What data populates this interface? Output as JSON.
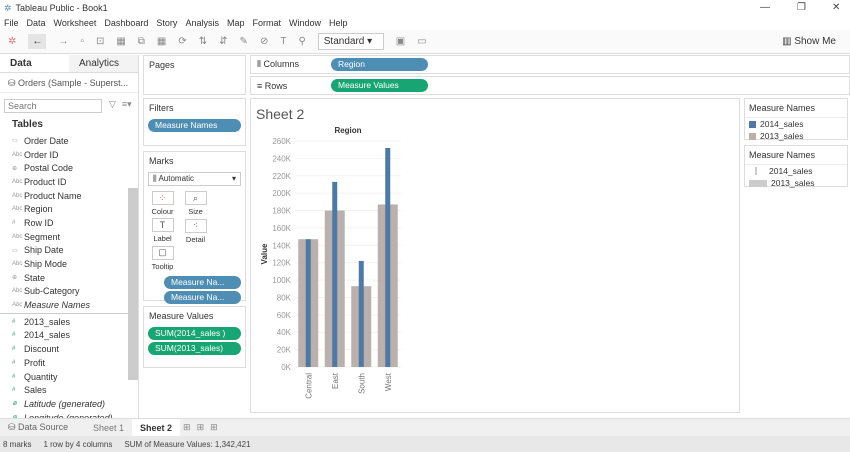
{
  "window": {
    "title": "Tableau Public - Book1"
  },
  "menu": [
    "File",
    "Data",
    "Worksheet",
    "Dashboard",
    "Story",
    "Analysis",
    "Map",
    "Format",
    "Window",
    "Help"
  ],
  "toolbar": {
    "fit": "Standard",
    "show_me": "Show Me"
  },
  "left": {
    "tabs": [
      "Data",
      "Analytics"
    ],
    "source": "Orders (Sample - Superst...",
    "search_placeholder": "Search",
    "tables_label": "Tables",
    "dimensions": [
      {
        "name": "Order Date",
        "icon": "date"
      },
      {
        "name": "Order ID",
        "icon": "abc"
      },
      {
        "name": "Postal Code",
        "icon": "geo"
      },
      {
        "name": "Product ID",
        "icon": "abc"
      },
      {
        "name": "Product Name",
        "icon": "abc"
      },
      {
        "name": "Region",
        "icon": "abc"
      },
      {
        "name": "Row ID",
        "icon": "num"
      },
      {
        "name": "Segment",
        "icon": "abc"
      },
      {
        "name": "Ship Date",
        "icon": "date"
      },
      {
        "name": "Ship Mode",
        "icon": "abc"
      },
      {
        "name": "State",
        "icon": "geo"
      },
      {
        "name": "Sub-Category",
        "icon": "abc"
      },
      {
        "name": "Measure Names",
        "icon": "abc"
      }
    ],
    "measures": [
      {
        "name": "2013_sales",
        "icon": "num"
      },
      {
        "name": "2014_sales",
        "icon": "num"
      },
      {
        "name": "Discount",
        "icon": "num"
      },
      {
        "name": "Profit",
        "icon": "num"
      },
      {
        "name": "Quantity",
        "icon": "num"
      },
      {
        "name": "Sales",
        "icon": "num"
      },
      {
        "name": "Latitude (generated)",
        "icon": "geo"
      },
      {
        "name": "Longitude (generated)",
        "icon": "geo"
      }
    ]
  },
  "pages": {
    "title": "Pages"
  },
  "filters": {
    "title": "Filters",
    "pills": [
      "Measure Names"
    ]
  },
  "marks": {
    "title": "Marks",
    "type": "Automatic",
    "buttons": [
      "Colour",
      "Size",
      "Label",
      "Detail",
      "Tooltip"
    ],
    "pills": [
      "Measure Na...",
      "Measure Na..."
    ]
  },
  "measure_values": {
    "title": "Measure Values",
    "pills": [
      "SUM(2014_sales )",
      "SUM(2013_sales)"
    ]
  },
  "shelves": {
    "columns_label": "Columns",
    "columns_pill": "Region",
    "rows_label": "Rows",
    "rows_pill": "Measure Values"
  },
  "sheet": {
    "title": "Sheet 2"
  },
  "legends": [
    {
      "title": "Measure Names",
      "items": [
        "2014_sales",
        "2013_sales"
      ]
    },
    {
      "title": "Measure Names",
      "items": [
        "2014_sales",
        "2013_sales"
      ]
    }
  ],
  "tabs": {
    "data_source": "Data Source",
    "sheets": [
      "Sheet 1",
      "Sheet 2"
    ],
    "active": "Sheet 2"
  },
  "status": {
    "marks": "8 marks",
    "dims": "1 row by 4 columns",
    "sum": "SUM of Measure Values: 1,342,421"
  },
  "colors": {
    "sales_2014": "#4e79a7",
    "sales_2013": "#bab0ac",
    "pill_blue": "#4f8eb4",
    "pill_green": "#17a673"
  },
  "chart_data": {
    "type": "bar",
    "title": "Region",
    "ylabel": "Value",
    "categories": [
      "Central",
      "East",
      "South",
      "West"
    ],
    "yticks": [
      "0K",
      "20K",
      "40K",
      "60K",
      "80K",
      "100K",
      "120K",
      "140K",
      "160K",
      "180K",
      "200K",
      "220K",
      "240K",
      "260K"
    ],
    "ylim": [
      0,
      260000
    ],
    "series": [
      {
        "name": "2013_sales",
        "values": [
          147000,
          180000,
          93000,
          187000
        ]
      },
      {
        "name": "2014_sales",
        "values": [
          147000,
          213000,
          122000,
          252000
        ]
      }
    ]
  }
}
